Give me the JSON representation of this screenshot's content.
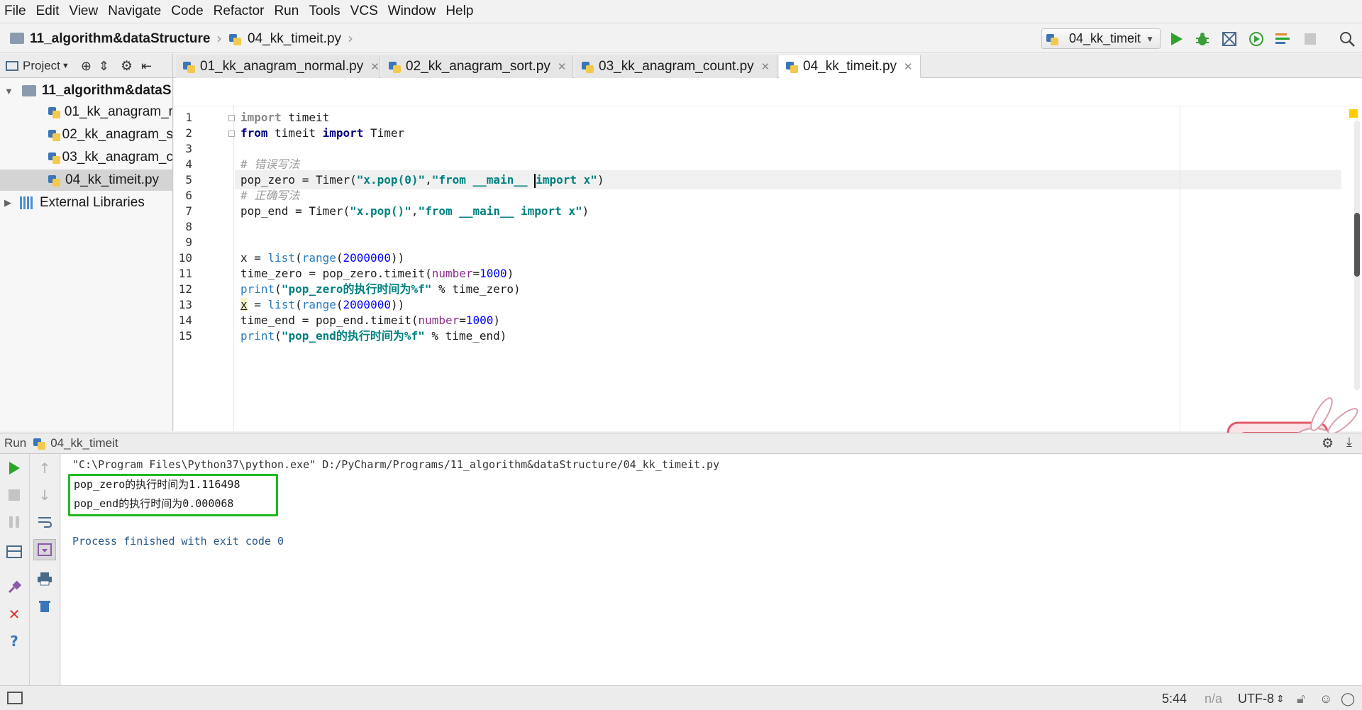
{
  "menu": [
    "File",
    "Edit",
    "View",
    "Navigate",
    "Code",
    "Refactor",
    "Run",
    "Tools",
    "VCS",
    "Window",
    "Help"
  ],
  "breadcrumb": {
    "project": "11_algorithm&dataStructure",
    "file": "04_kk_timeit.py"
  },
  "run_config": {
    "label": "04_kk_timeit"
  },
  "project_panel": {
    "header": "Project"
  },
  "tabs": [
    {
      "label": "01_kk_anagram_normal.py",
      "active": false
    },
    {
      "label": "02_kk_anagram_sort.py",
      "active": false
    },
    {
      "label": "03_kk_anagram_count.py",
      "active": false
    },
    {
      "label": "04_kk_timeit.py",
      "active": true
    }
  ],
  "tree": {
    "root": "11_algorithm&dataS",
    "files": [
      "01_kk_anagram_r",
      "02_kk_anagram_s",
      "03_kk_anagram_c",
      "04_kk_timeit.py"
    ],
    "external": "External Libraries"
  },
  "code_lines": [
    {
      "n": "1",
      "tokens": [
        [
          "kw-grey",
          "import"
        ],
        [
          "plain",
          " timeit"
        ]
      ]
    },
    {
      "n": "2",
      "tokens": [
        [
          "kw",
          "from"
        ],
        [
          "plain",
          " timeit "
        ],
        [
          "kw",
          "import"
        ],
        [
          "plain",
          " Timer"
        ]
      ]
    },
    {
      "n": "3",
      "tokens": []
    },
    {
      "n": "4",
      "tokens": [
        [
          "cmt",
          "# 错误写法"
        ]
      ]
    },
    {
      "n": "5",
      "tokens": [
        [
          "plain",
          "pop_zero = Timer("
        ],
        [
          "str",
          "\"x.pop(0)\""
        ],
        [
          "plain",
          ","
        ],
        [
          "str",
          "\"from __main__ "
        ],
        [
          "caret",
          ""
        ],
        [
          "str",
          "import x\""
        ],
        [
          "plain",
          ")"
        ]
      ]
    },
    {
      "n": "6",
      "tokens": [
        [
          "cmt",
          "# 正确写法"
        ]
      ]
    },
    {
      "n": "7",
      "tokens": [
        [
          "plain",
          "pop_end = Timer("
        ],
        [
          "str",
          "\"x.pop()\""
        ],
        [
          "plain",
          ","
        ],
        [
          "str",
          "\"from __main__ import x\""
        ],
        [
          "plain",
          ")"
        ]
      ]
    },
    {
      "n": "8",
      "tokens": []
    },
    {
      "n": "9",
      "tokens": []
    },
    {
      "n": "10",
      "tokens": [
        [
          "plain",
          "x = "
        ],
        [
          "bi",
          "list"
        ],
        [
          "plain",
          "("
        ],
        [
          "bi",
          "range"
        ],
        [
          "plain",
          "("
        ],
        [
          "num",
          "2000000"
        ],
        [
          "plain",
          "))"
        ]
      ]
    },
    {
      "n": "11",
      "tokens": [
        [
          "plain",
          "time_zero = pop_zero.timeit("
        ],
        [
          "param",
          "number"
        ],
        [
          "plain",
          "="
        ],
        [
          "num",
          "1000"
        ],
        [
          "plain",
          ")"
        ]
      ]
    },
    {
      "n": "12",
      "tokens": [
        [
          "bi",
          "print"
        ],
        [
          "plain",
          "("
        ],
        [
          "str",
          "\"pop_zero的执行时间为%f\""
        ],
        [
          "plain",
          " % time_zero)"
        ]
      ]
    },
    {
      "n": "13",
      "tokens": [
        [
          "warn",
          "x"
        ],
        [
          "plain",
          " = "
        ],
        [
          "bi",
          "list"
        ],
        [
          "plain",
          "("
        ],
        [
          "bi",
          "range"
        ],
        [
          "plain",
          "("
        ],
        [
          "num",
          "2000000"
        ],
        [
          "plain",
          "))"
        ]
      ]
    },
    {
      "n": "14",
      "tokens": [
        [
          "plain",
          "time_end = pop_end.timeit("
        ],
        [
          "param",
          "number"
        ],
        [
          "plain",
          "="
        ],
        [
          "num",
          "1000"
        ],
        [
          "plain",
          ")"
        ]
      ]
    },
    {
      "n": "15",
      "tokens": [
        [
          "bi",
          "print"
        ],
        [
          "plain",
          "("
        ],
        [
          "str",
          "\"pop_end的执行时间为%f\""
        ],
        [
          "plain",
          " % time_end)"
        ]
      ]
    }
  ],
  "run_panel": {
    "label": "Run",
    "config": "04_kk_timeit"
  },
  "console": {
    "command": "\"C:\\Program Files\\Python37\\python.exe\" D:/PyCharm/Programs/11_algorithm&dataStructure/04_kk_timeit.py",
    "output": [
      "pop_zero的执行时间为1.116498",
      "pop_end的执行时间为0.000068"
    ],
    "finish": "Process finished with exit code 0"
  },
  "status": {
    "position": "5:44",
    "na": "n/a",
    "encoding": "UTF-8"
  },
  "colors": {
    "run_green": "#2aa52a",
    "highlight_box": "#1fb91f",
    "string": "#008080",
    "keyword": "#000080"
  }
}
